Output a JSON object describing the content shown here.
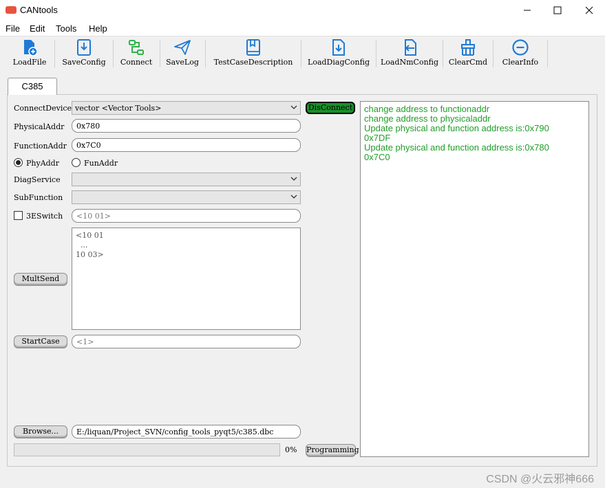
{
  "window": {
    "title": "CANtools",
    "minimize": "—",
    "maximize": "☐",
    "close": "✕"
  },
  "menu": [
    "File",
    "Edit",
    "Tools",
    "Help"
  ],
  "toolbar": [
    {
      "label": "LoadFile",
      "icon": "file-add-icon"
    },
    {
      "label": "SaveConfig",
      "icon": "save-download-icon"
    },
    {
      "label": "Connect",
      "icon": "connect-icon"
    },
    {
      "label": "SaveLog",
      "icon": "send-plane-icon"
    },
    {
      "label": "TestCaseDescription",
      "icon": "book-icon"
    },
    {
      "label": "LoadDiagConfig",
      "icon": "download-file-icon"
    },
    {
      "label": "LoadNmConfig",
      "icon": "import-file-icon"
    },
    {
      "label": "ClearCmd",
      "icon": "broom-icon"
    },
    {
      "label": "ClearInfo",
      "icon": "minus-circle-icon"
    }
  ],
  "tab": {
    "label": "C385"
  },
  "form": {
    "connect_device_label": "ConnectDevice",
    "connect_device_value": "vector <Vector Tools>",
    "disconnect_button": "DisConnect",
    "physical_addr_label": "PhysicalAddr",
    "physical_addr_value": "0x780",
    "function_addr_label": "FunctionAddr",
    "function_addr_value": "0x7C0",
    "phy_radio_label": "PhyAddr",
    "fun_radio_label": "FunAddr",
    "phy_selected": true,
    "diag_service_label": "DiagService",
    "sub_function_label": "SubFunction",
    "switch_3e_label": "3ESwitch",
    "switch_3e_placeholder": "<10 01>",
    "mult_send_button": "MultSend",
    "mult_placeholder": "<10 01\n  ...\n10 03>",
    "start_case_button": "StartCase",
    "start_case_placeholder": "<1>",
    "browse_button": "Browse...",
    "browse_path": "E:/liquan/Project_SVN/config_tools_pyqt5/c385.dbc",
    "progress_percent": 0,
    "progress_text": "0%",
    "programming_button": "Programming"
  },
  "log_lines": [
    "change address to functionaddr",
    "change address to physicaladdr",
    "Update physical and function address is:0x790",
    "0x7DF",
    "Update physical and function address is:0x780",
    "0x7C0"
  ],
  "watermark": "CSDN @火云邪神666",
  "colors": {
    "log_text": "#1f9d28",
    "accent_blue": "#1e7ad6",
    "accent_green": "#2fb14a",
    "disconnect_bg": "#1a8f2a"
  }
}
